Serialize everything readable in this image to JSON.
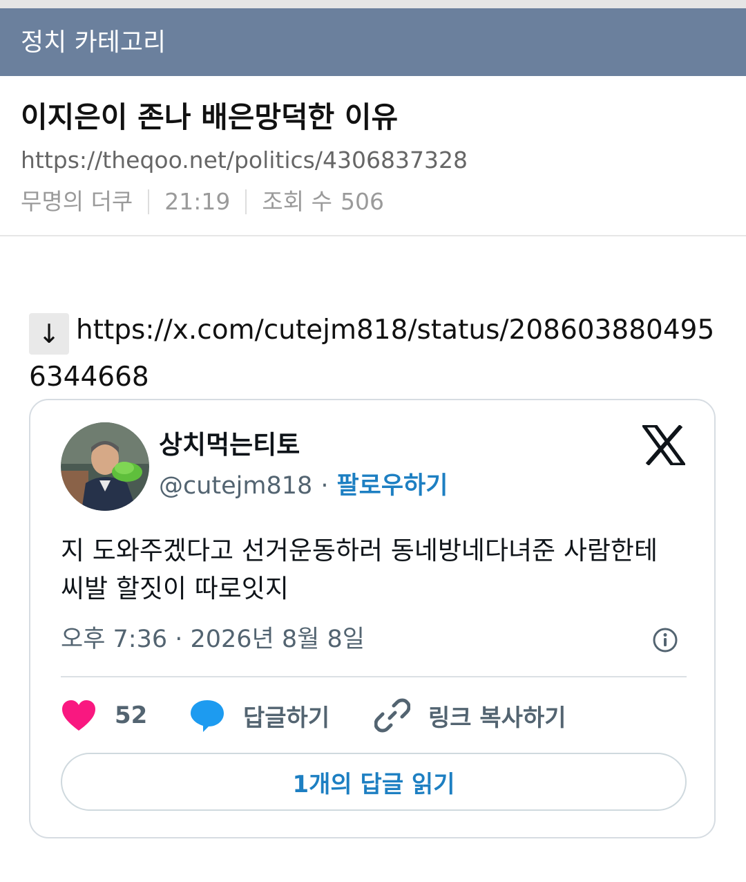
{
  "category": {
    "label": "정치 카테고리"
  },
  "post": {
    "title": "이지은이 존나 배은망덕한 이유",
    "url": "https://theqoo.net/politics/4306837328",
    "author": "무명의 더쿠",
    "time": "21:19",
    "views_label": "조회 수",
    "views": "506"
  },
  "link": {
    "arrow": "↓",
    "url": "https://x.com/cutejm818/status/2086038804956344668"
  },
  "tweet": {
    "display_name": "상치먹는티토",
    "handle": "@cutejm818",
    "separator": "·",
    "follow_label": "팔로우하기",
    "text": "지 도와주겠다고 선거운동하러 동네방네다녀준 사람한테 씨발 할짓이 따로잇지",
    "timestamp": "오후 7:36 · 2026년 8월 8일",
    "likes": "52",
    "reply_label": "답글하기",
    "copy_link_label": "링크 복사하기",
    "read_replies_label": "1개의 답글 읽기"
  },
  "colors": {
    "category_bar": "#6b809d",
    "link_blue": "#1d7fc2",
    "like_pink": "#f91880",
    "reply_blue": "#1d9bf0"
  },
  "icons": [
    "down-arrow-icon",
    "x-logo-icon",
    "info-icon",
    "heart-icon",
    "speech-bubble-icon",
    "link-icon"
  ]
}
